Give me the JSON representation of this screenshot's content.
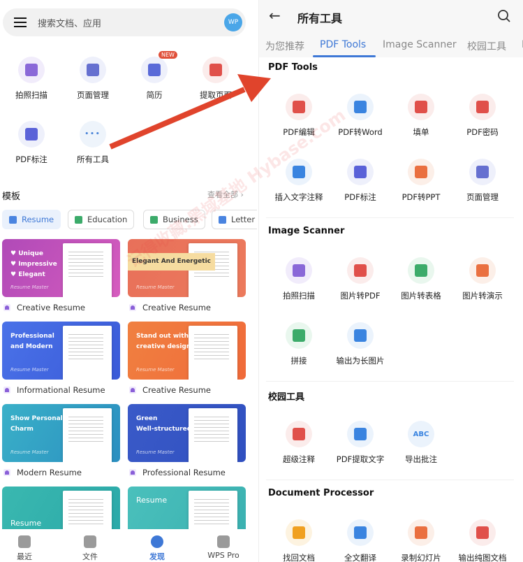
{
  "left": {
    "search_placeholder": "搜索文档、应用",
    "avatar": "WP",
    "tools": [
      {
        "label": "拍照扫描",
        "icon": "scan-icon",
        "bg": "#f1ecfb",
        "fg": "#8a68d8"
      },
      {
        "label": "页面管理",
        "icon": "page-manage-icon",
        "bg": "#eef0fb",
        "fg": "#6670d0"
      },
      {
        "label": "简历",
        "icon": "resume-icon",
        "bg": "#eef0fb",
        "fg": "#5a6ad8",
        "badge": "NEW"
      },
      {
        "label": "提取页面",
        "icon": "extract-page-icon",
        "bg": "#fbeceb",
        "fg": "#e0504a"
      },
      {
        "label": "PDF标注",
        "icon": "pdf-annotate-icon",
        "bg": "#eef0fb",
        "fg": "#5a62d8"
      },
      {
        "label": "所有工具",
        "icon": "more-icon",
        "bg": "#eef4fb",
        "fg": "#4a84d8"
      }
    ],
    "templates_title": "模板",
    "view_all": "查看全部 ›",
    "chips": [
      {
        "label": "Resume",
        "color": "#4a84e0"
      },
      {
        "label": "Education",
        "color": "#3cab6a"
      },
      {
        "label": "Business",
        "color": "#3cab6a"
      },
      {
        "label": "Letter",
        "color": "#4a84e0"
      }
    ],
    "cards": [
      {
        "title": "Creative Resume",
        "text": "♥ Unique\n♥ Impressive\n♥ Elegant",
        "brand": "Resume Master",
        "bg": "linear-gradient(120deg,#b04ab8,#d65cbe)"
      },
      {
        "title": "Creative Resume",
        "text": "Elegant And Energetic",
        "brand": "Resume Master",
        "bg": "linear-gradient(120deg,#e8705a,#ec7a5c)"
      },
      {
        "title": "Informational Resume",
        "text": "Professional\nand Modern",
        "brand": "Resume Master",
        "bg": "linear-gradient(120deg,#4a72e8,#3a5ad8)"
      },
      {
        "title": "Creative Resume",
        "text": "Stand out with\ncreative design",
        "brand": "Resume Master",
        "bg": "linear-gradient(120deg,#f08040,#f06a3a)"
      },
      {
        "title": "Modern Resume",
        "text": "Show Personal\nCharm",
        "brand": "Resume Master",
        "bg": "linear-gradient(120deg,#3ab0c8,#2a8ec0)"
      },
      {
        "title": "Professional Resume",
        "text": "Green\nWell-structured",
        "brand": "Resume Master",
        "bg": "linear-gradient(120deg,#3a5ac8,#3050c0)"
      },
      {
        "title": "",
        "text": "Resume",
        "brand": "",
        "bg": "linear-gradient(120deg,#3ab8b0,#2aa8a8)"
      },
      {
        "title": "",
        "text": "Resume",
        "brand": "",
        "bg": "linear-gradient(120deg,#4ac0bc,#3ab0b0)"
      }
    ],
    "nav": [
      {
        "label": "最近",
        "active": false
      },
      {
        "label": "文件",
        "active": false
      },
      {
        "label": "发现",
        "active": true
      },
      {
        "label": "WPS Pro",
        "active": false
      }
    ]
  },
  "right": {
    "title": "所有工具",
    "tabs": [
      "为您推荐",
      "PDF Tools",
      "Image Scanner",
      "校园工具",
      "D"
    ],
    "active_tab": "PDF Tools",
    "sections": [
      {
        "title": "PDF Tools",
        "items": [
          {
            "label": "PDF编辑",
            "icon": "pdf-edit-icon",
            "bg": "#fbeceb",
            "fg": "#e0504a"
          },
          {
            "label": "PDF转Word",
            "icon": "pdf-to-word-icon",
            "bg": "#ebf3fc",
            "fg": "#3a84e0"
          },
          {
            "label": "填单",
            "icon": "fill-form-icon",
            "bg": "#fbeceb",
            "fg": "#e0504a"
          },
          {
            "label": "PDF密码",
            "icon": "lock-icon",
            "bg": "#fbeceb",
            "fg": "#e0504a"
          },
          {
            "label": "插入文字注释",
            "icon": "text-annotate-icon",
            "bg": "#ebf3fc",
            "fg": "#3a84e0"
          },
          {
            "label": "PDF标注",
            "icon": "pdf-annotate-icon",
            "bg": "#eef0fb",
            "fg": "#5a62d8"
          },
          {
            "label": "PDF转PPT",
            "icon": "pdf-to-ppt-icon",
            "bg": "#fcefe8",
            "fg": "#ea7040"
          },
          {
            "label": "页面管理",
            "icon": "page-manage-icon",
            "bg": "#eef0fb",
            "fg": "#6670d0"
          }
        ]
      },
      {
        "title": "Image Scanner",
        "items": [
          {
            "label": "拍照扫描",
            "icon": "scan-icon",
            "bg": "#f1ecfb",
            "fg": "#8a68d8"
          },
          {
            "label": "图片转PDF",
            "icon": "image-to-pdf-icon",
            "bg": "#fbeceb",
            "fg": "#e0504a"
          },
          {
            "label": "图片转表格",
            "icon": "image-to-sheet-icon",
            "bg": "#e9f7ee",
            "fg": "#3cab6a"
          },
          {
            "label": "图片转演示",
            "icon": "image-to-ppt-icon",
            "bg": "#fcefe8",
            "fg": "#ea7040"
          },
          {
            "label": "拼接",
            "icon": "stitch-icon",
            "bg": "#e9f7ee",
            "fg": "#3cab6a"
          },
          {
            "label": "输出为长图片",
            "icon": "long-image-icon",
            "bg": "#ebf3fc",
            "fg": "#3a84e0"
          }
        ]
      },
      {
        "title": "校园工具",
        "items": [
          {
            "label": "超级注释",
            "icon": "super-annotate-icon",
            "bg": "#fbeceb",
            "fg": "#e0504a"
          },
          {
            "label": "PDF提取文字",
            "icon": "pdf-extract-text-icon",
            "bg": "#ebf3fc",
            "fg": "#3a84e0"
          },
          {
            "label": "导出批注",
            "icon": "export-comments-icon",
            "bg": "#ebf3fc",
            "fg": "#3a84e0",
            "text": "ABC"
          }
        ]
      },
      {
        "title": "Document Processor",
        "items": [
          {
            "label": "找回文档",
            "icon": "recover-doc-icon",
            "bg": "#fdf3e0",
            "fg": "#f0a020"
          },
          {
            "label": "全文翻译",
            "icon": "translate-icon",
            "bg": "#ebf3fc",
            "fg": "#3a84e0"
          },
          {
            "label": "录制幻灯片",
            "icon": "record-slides-icon",
            "bg": "#fcefe8",
            "fg": "#ea7040"
          },
          {
            "label": "输出纯图文档",
            "icon": "image-doc-icon",
            "bg": "#fbeceb",
            "fg": "#e0504a"
          }
        ]
      }
    ]
  },
  "overlay": {
    "arrow_color": "#e0442c",
    "watermark": "记得收藏:黑域基地 Hybase.com"
  }
}
